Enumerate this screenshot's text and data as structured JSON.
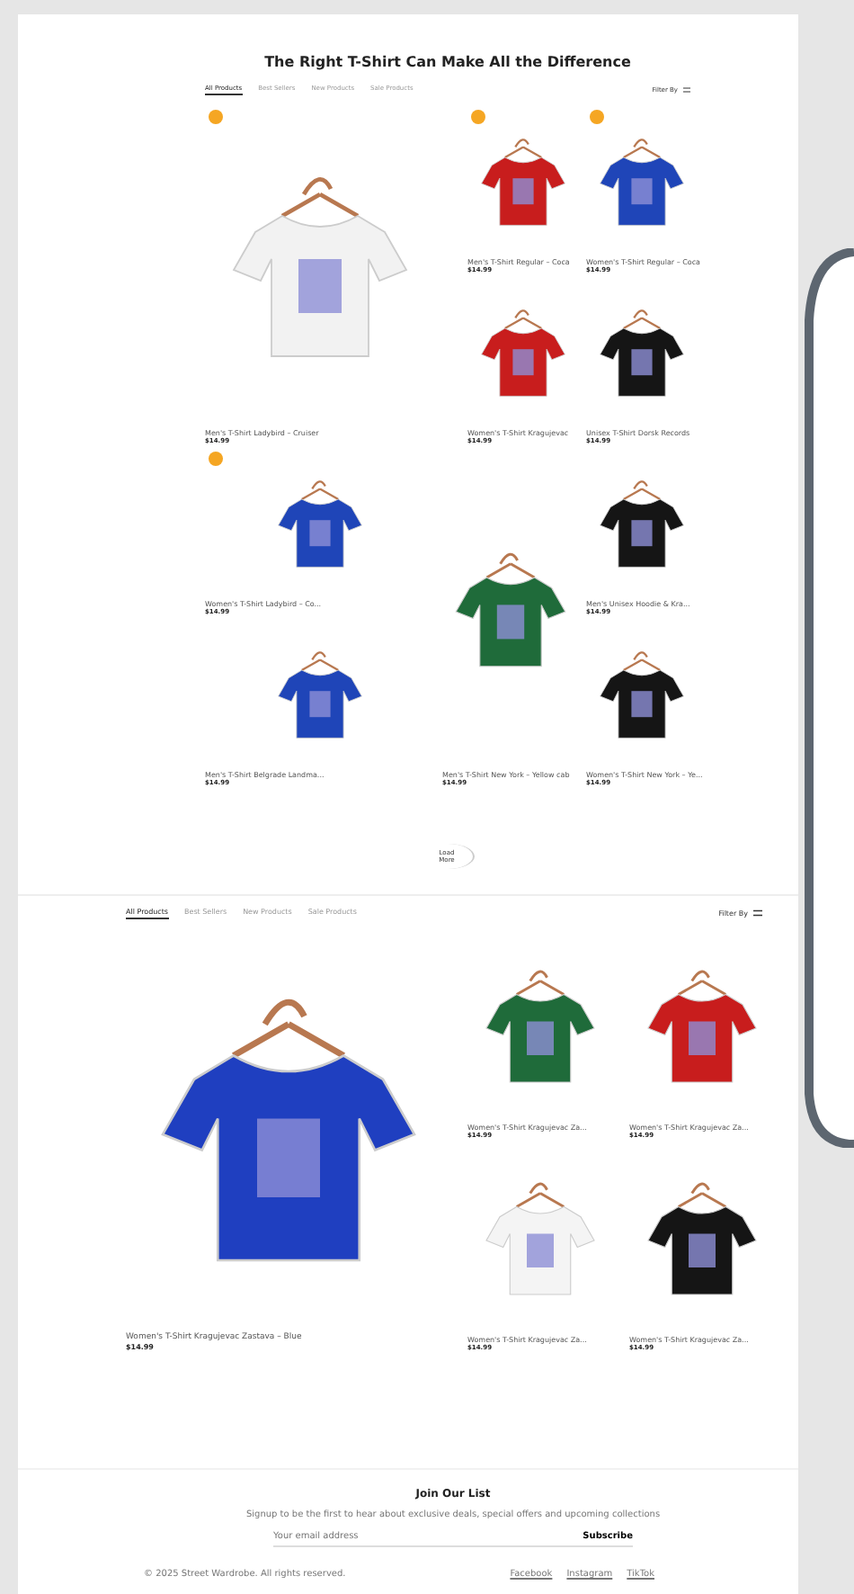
{
  "hero": {
    "title": "The Right T-Shirt Can Make All the Difference"
  },
  "tabs": [
    {
      "label": "All Products",
      "selected": true
    },
    {
      "label": "Best Sellers",
      "selected": false
    },
    {
      "label": "New Products",
      "selected": false
    },
    {
      "label": "Sale Products",
      "selected": false
    }
  ],
  "filter": {
    "label": "Filter By"
  },
  "products": [
    {
      "name": "Men's T-Shirt Ladybird – Cruiser",
      "price": "$14.99",
      "color": "#f2f2f2",
      "badge": true
    },
    {
      "name": "Men's T-Shirt Regular – Coca",
      "price": "$14.99",
      "color": "#c81d1d",
      "badge": true
    },
    {
      "name": "Women's T-Shirt Regular – Coca",
      "price": "$14.99",
      "color": "#1f45b8",
      "badge": true
    },
    {
      "name": "Women's T-Shirt Kragujevac",
      "price": "$14.99",
      "color": "#c81d1d",
      "badge": false
    },
    {
      "name": "Unisex T-Shirt Dorsk Records",
      "price": "$14.99",
      "color": "#151515",
      "badge": false
    },
    {
      "name": "Women's T-Shirt Ladybird – Co...",
      "price": "$14.99",
      "color": "#1f45b8",
      "badge": true
    },
    {
      "name": "Men's T-Shirt New York – Yellow cab",
      "price": "$14.99",
      "color": "#1f6b3a",
      "badge": false
    },
    {
      "name": "Men's Unisex Hoodie & Kra...",
      "price": "$14.99",
      "color": "#151515",
      "badge": false
    },
    {
      "name": "Men's T-Shirt Belgrade Landma...",
      "price": "$14.99",
      "color": "#1f45b8",
      "badge": false
    },
    {
      "name": "Women's T-Shirt New York – Ye...",
      "price": "$14.99",
      "color": "#151515",
      "badge": false
    }
  ],
  "load_more": {
    "label": "Load More"
  },
  "tabs_2": [
    {
      "label": "All Products",
      "selected": true
    },
    {
      "label": "Best Sellers",
      "selected": false
    },
    {
      "label": "New Products",
      "selected": false
    },
    {
      "label": "Sale Products",
      "selected": false
    }
  ],
  "filter_2": {
    "label": "Filter By"
  },
  "featured": {
    "name": "Women's T-Shirt Kragujevac Zastava – Blue",
    "price": "$14.99",
    "color": "#1f3fc0"
  },
  "products_2": [
    {
      "name": "Women's T-Shirt Kragujevac Za...",
      "price": "$14.99",
      "color": "#1f6b3a"
    },
    {
      "name": "Women's T-Shirt Kragujevac Za...",
      "price": "$14.99",
      "color": "#c81d1d"
    },
    {
      "name": "Women's T-Shirt Kragujevac Za...",
      "price": "$14.99",
      "color": "#f4f4f4"
    },
    {
      "name": "Women's T-Shirt Kragujevac Za...",
      "price": "$14.99",
      "color": "#151515"
    }
  ],
  "newsletter": {
    "title": "Join Our List",
    "text": "Signup to be the first to hear about exclusive deals, special offers and upcoming collections",
    "placeholder": "Your email address",
    "button": "Subscribe"
  },
  "footer": {
    "copyright": "© 2025 Street Wardrobe. All rights reserved.",
    "links": [
      "Facebook",
      "Instagram",
      "TikTok"
    ]
  }
}
